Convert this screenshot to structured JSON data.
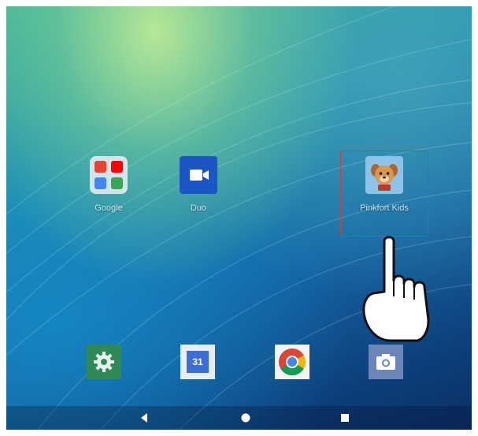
{
  "home_screen": {
    "apps": [
      {
        "label": "Google",
        "icon": "google-folder-icon"
      },
      {
        "label": "Duo",
        "icon": "duo-video-icon"
      },
      {
        "label": "Pinkfort Kids",
        "icon": "dog-app-icon"
      }
    ],
    "dock": [
      {
        "icon": "settings-icon"
      },
      {
        "icon": "calendar-icon",
        "text": "31"
      },
      {
        "icon": "chrome-icon"
      },
      {
        "icon": "camera-icon"
      }
    ]
  },
  "nav_bar": {
    "buttons": [
      "back-icon",
      "home-icon",
      "recents-icon"
    ]
  },
  "overlay": {
    "highlight_color": "#d23c3c",
    "pointer": "hand-pointer-icon"
  }
}
